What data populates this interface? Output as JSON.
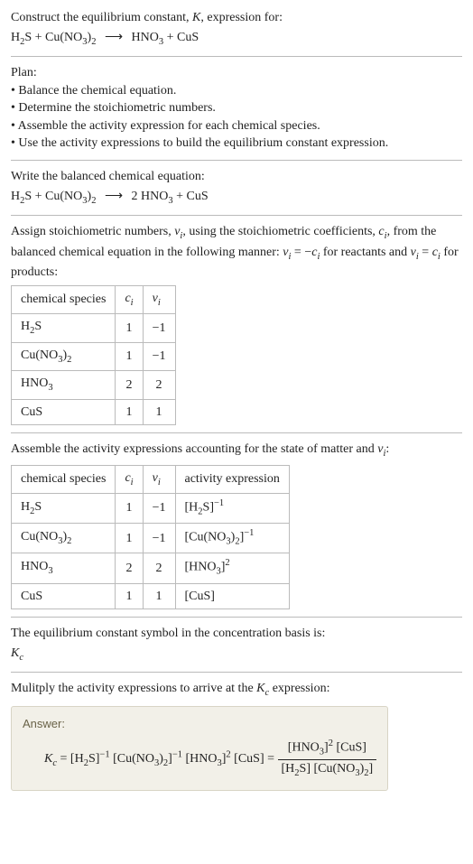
{
  "header": {
    "line1_pre": "Construct the equilibrium constant, ",
    "line1_mid": "K",
    "line1_post": ", expression for:",
    "eq_lhs1": "H",
    "eq_lhs1_sub": "2",
    "eq_lhs1b": "S + Cu(NO",
    "eq_lhs1b_sub": "3",
    "eq_lhs1c": ")",
    "eq_lhs1c_sub": "2",
    "arrow": "⟶",
    "eq_rhs1": "HNO",
    "eq_rhs1_sub": "3",
    "eq_rhs1b": " + CuS"
  },
  "plan": {
    "title": "Plan:",
    "b1": "• Balance the chemical equation.",
    "b2": "• Determine the stoichiometric numbers.",
    "b3": "• Assemble the activity expression for each chemical species.",
    "b4": "• Use the activity expressions to build the equilibrium constant expression."
  },
  "balanced": {
    "title": "Write the balanced chemical equation:",
    "lhs1": "H",
    "lhs1_sub": "2",
    "lhs1b": "S + Cu(NO",
    "lhs1b_sub": "3",
    "lhs1c": ")",
    "lhs1c_sub": "2",
    "arrow": "⟶",
    "rhs1": "2 HNO",
    "rhs1_sub": "3",
    "rhs1b": " + CuS"
  },
  "stoich": {
    "intro1": "Assign stoichiometric numbers, ",
    "nu": "ν",
    "i": "i",
    "intro2": ", using the stoichiometric coefficients, ",
    "c": "c",
    "intro3": ", from the balanced chemical equation in the following manner: ",
    "rel1a": "ν",
    "rel1b": " = −",
    "rel1c": "c",
    "rel1d": " for reactants and ",
    "rel2a": "ν",
    "rel2b": " = ",
    "rel2c": "c",
    "rel2d": " for products:",
    "headers": {
      "h1": "chemical species",
      "h2": "c",
      "h2i": "i",
      "h3": "ν",
      "h3i": "i"
    },
    "rows": [
      {
        "sp_a": "H",
        "sp_asub": "2",
        "sp_b": "S",
        "c": "1",
        "v": "−1"
      },
      {
        "sp_a": "Cu(NO",
        "sp_asub": "3",
        "sp_b": ")",
        "sp_bsub": "2",
        "c": "1",
        "v": "−1"
      },
      {
        "sp_a": "HNO",
        "sp_asub": "3",
        "sp_b": "",
        "c": "2",
        "v": "2"
      },
      {
        "sp_a": "CuS",
        "sp_asub": "",
        "sp_b": "",
        "c": "1",
        "v": "1"
      }
    ]
  },
  "activity": {
    "title_a": "Assemble the activity expressions accounting for the state of matter and ",
    "title_nu": "ν",
    "title_i": "i",
    "title_b": ":",
    "headers": {
      "h1": "chemical species",
      "h2": "c",
      "h2i": "i",
      "h3": "ν",
      "h3i": "i",
      "h4": "activity expression"
    },
    "rows": [
      {
        "sp_a": "H",
        "sp_asub": "2",
        "sp_b": "S",
        "sp_bsub": "",
        "c": "1",
        "v": "−1",
        "ae_a": "[H",
        "ae_asub": "2",
        "ae_b": "S]",
        "ae_sup": "−1"
      },
      {
        "sp_a": "Cu(NO",
        "sp_asub": "3",
        "sp_b": ")",
        "sp_bsub": "2",
        "c": "1",
        "v": "−1",
        "ae_a": "[Cu(NO",
        "ae_asub": "3",
        "ae_b": ")",
        "ae_bsub": "2",
        "ae_c": "]",
        "ae_sup": "−1"
      },
      {
        "sp_a": "HNO",
        "sp_asub": "3",
        "sp_b": "",
        "sp_bsub": "",
        "c": "2",
        "v": "2",
        "ae_a": "[HNO",
        "ae_asub": "3",
        "ae_b": "]",
        "ae_sup": "2"
      },
      {
        "sp_a": "CuS",
        "sp_asub": "",
        "sp_b": "",
        "sp_bsub": "",
        "c": "1",
        "v": "1",
        "ae_a": "[CuS]",
        "ae_asub": "",
        "ae_b": "",
        "ae_sup": ""
      }
    ]
  },
  "ksymbol": {
    "line": "The equilibrium constant symbol in the concentration basis is:",
    "K": "K",
    "c": "c"
  },
  "final": {
    "intro_a": "Mulitply the activity expressions to arrive at the ",
    "intro_K": "K",
    "intro_c": "c",
    "intro_b": " expression:",
    "answer_label": "Answer:",
    "Kc_K": "K",
    "Kc_c": "c",
    "eq": " = ",
    "t1a": "[H",
    "t1asub": "2",
    "t1b": "S]",
    "t1sup": "−1",
    "t2a": " [Cu(NO",
    "t2asub": "3",
    "t2b": ")",
    "t2bsub": "2",
    "t2c": "]",
    "t2sup": "−1",
    "t3a": " [HNO",
    "t3asub": "3",
    "t3b": "]",
    "t3sup": "2",
    "t4": " [CuS] = ",
    "num_a": "[HNO",
    "num_asub": "3",
    "num_b": "]",
    "num_sup": "2",
    "num_c": " [CuS]",
    "den_a": "[H",
    "den_asub": "2",
    "den_b": "S] [Cu(NO",
    "den_bsub": "3",
    "den_c": ")",
    "den_csub": "2",
    "den_d": "]"
  }
}
